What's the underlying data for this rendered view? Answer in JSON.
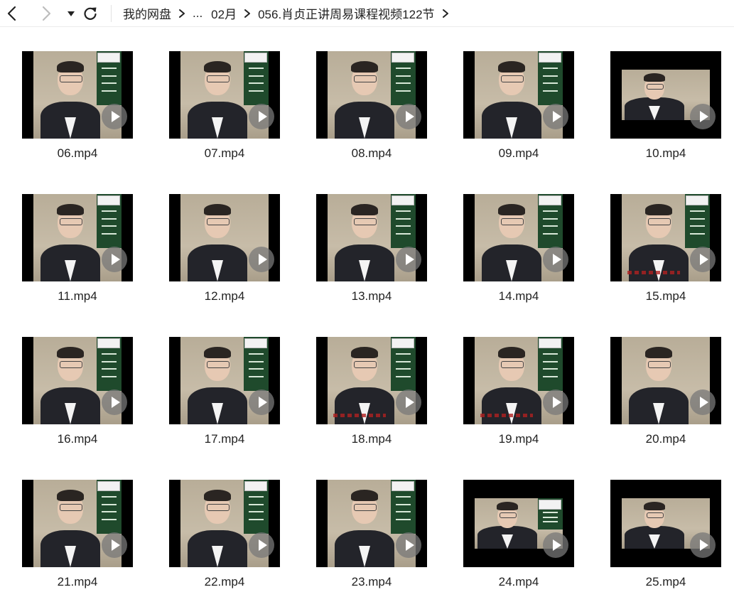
{
  "toolbar": {
    "breadcrumb": [
      "我的网盘",
      "...",
      "02月",
      "056.肖贞正讲周易课程视频122节"
    ]
  },
  "files": [
    {
      "name": "06.mp4",
      "thumb": "board",
      "letterbox": false
    },
    {
      "name": "07.mp4",
      "thumb": "board",
      "letterbox": false
    },
    {
      "name": "08.mp4",
      "thumb": "board",
      "letterbox": false
    },
    {
      "name": "09.mp4",
      "thumb": "board",
      "letterbox": false
    },
    {
      "name": "10.mp4",
      "thumb": "plain",
      "letterbox": true
    },
    {
      "name": "11.mp4",
      "thumb": "board",
      "letterbox": false
    },
    {
      "name": "12.mp4",
      "thumb": "plain",
      "letterbox": false
    },
    {
      "name": "13.mp4",
      "thumb": "board",
      "letterbox": false
    },
    {
      "name": "14.mp4",
      "thumb": "board",
      "letterbox": false
    },
    {
      "name": "15.mp4",
      "thumb": "board-caption",
      "letterbox": false
    },
    {
      "name": "16.mp4",
      "thumb": "board",
      "letterbox": false
    },
    {
      "name": "17.mp4",
      "thumb": "board",
      "letterbox": false
    },
    {
      "name": "18.mp4",
      "thumb": "board-caption",
      "letterbox": false
    },
    {
      "name": "19.mp4",
      "thumb": "board-caption",
      "letterbox": false
    },
    {
      "name": "20.mp4",
      "thumb": "plain",
      "letterbox": false
    },
    {
      "name": "21.mp4",
      "thumb": "board",
      "letterbox": false
    },
    {
      "name": "22.mp4",
      "thumb": "board",
      "letterbox": false
    },
    {
      "name": "23.mp4",
      "thumb": "board",
      "letterbox": false
    },
    {
      "name": "24.mp4",
      "thumb": "board",
      "letterbox": true
    },
    {
      "name": "25.mp4",
      "thumb": "plain",
      "letterbox": true
    }
  ],
  "icons": {
    "back": "chevron-left-icon",
    "forward": "chevron-right-icon",
    "dropdown": "caret-down-icon",
    "refresh": "refresh-icon",
    "breadcrumb_separator": "chevron-right-icon",
    "play": "play-icon"
  },
  "colors": {
    "active_icon": "#222222",
    "disabled_icon": "#bdbdbd",
    "board": "#1f4a2c",
    "play_overlay": "#787878"
  }
}
